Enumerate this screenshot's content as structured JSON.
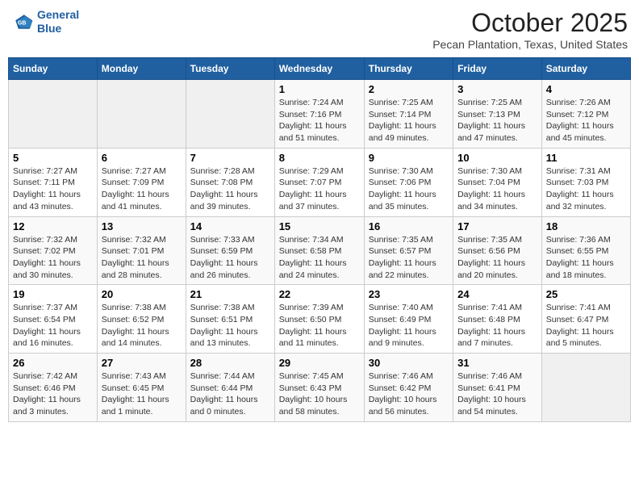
{
  "header": {
    "logo_line1": "General",
    "logo_line2": "Blue",
    "month": "October 2025",
    "location": "Pecan Plantation, Texas, United States"
  },
  "weekdays": [
    "Sunday",
    "Monday",
    "Tuesday",
    "Wednesday",
    "Thursday",
    "Friday",
    "Saturday"
  ],
  "weeks": [
    [
      {
        "day": "",
        "info": ""
      },
      {
        "day": "",
        "info": ""
      },
      {
        "day": "",
        "info": ""
      },
      {
        "day": "1",
        "info": "Sunrise: 7:24 AM\nSunset: 7:16 PM\nDaylight: 11 hours\nand 51 minutes."
      },
      {
        "day": "2",
        "info": "Sunrise: 7:25 AM\nSunset: 7:14 PM\nDaylight: 11 hours\nand 49 minutes."
      },
      {
        "day": "3",
        "info": "Sunrise: 7:25 AM\nSunset: 7:13 PM\nDaylight: 11 hours\nand 47 minutes."
      },
      {
        "day": "4",
        "info": "Sunrise: 7:26 AM\nSunset: 7:12 PM\nDaylight: 11 hours\nand 45 minutes."
      }
    ],
    [
      {
        "day": "5",
        "info": "Sunrise: 7:27 AM\nSunset: 7:11 PM\nDaylight: 11 hours\nand 43 minutes."
      },
      {
        "day": "6",
        "info": "Sunrise: 7:27 AM\nSunset: 7:09 PM\nDaylight: 11 hours\nand 41 minutes."
      },
      {
        "day": "7",
        "info": "Sunrise: 7:28 AM\nSunset: 7:08 PM\nDaylight: 11 hours\nand 39 minutes."
      },
      {
        "day": "8",
        "info": "Sunrise: 7:29 AM\nSunset: 7:07 PM\nDaylight: 11 hours\nand 37 minutes."
      },
      {
        "day": "9",
        "info": "Sunrise: 7:30 AM\nSunset: 7:06 PM\nDaylight: 11 hours\nand 35 minutes."
      },
      {
        "day": "10",
        "info": "Sunrise: 7:30 AM\nSunset: 7:04 PM\nDaylight: 11 hours\nand 34 minutes."
      },
      {
        "day": "11",
        "info": "Sunrise: 7:31 AM\nSunset: 7:03 PM\nDaylight: 11 hours\nand 32 minutes."
      }
    ],
    [
      {
        "day": "12",
        "info": "Sunrise: 7:32 AM\nSunset: 7:02 PM\nDaylight: 11 hours\nand 30 minutes."
      },
      {
        "day": "13",
        "info": "Sunrise: 7:32 AM\nSunset: 7:01 PM\nDaylight: 11 hours\nand 28 minutes."
      },
      {
        "day": "14",
        "info": "Sunrise: 7:33 AM\nSunset: 6:59 PM\nDaylight: 11 hours\nand 26 minutes."
      },
      {
        "day": "15",
        "info": "Sunrise: 7:34 AM\nSunset: 6:58 PM\nDaylight: 11 hours\nand 24 minutes."
      },
      {
        "day": "16",
        "info": "Sunrise: 7:35 AM\nSunset: 6:57 PM\nDaylight: 11 hours\nand 22 minutes."
      },
      {
        "day": "17",
        "info": "Sunrise: 7:35 AM\nSunset: 6:56 PM\nDaylight: 11 hours\nand 20 minutes."
      },
      {
        "day": "18",
        "info": "Sunrise: 7:36 AM\nSunset: 6:55 PM\nDaylight: 11 hours\nand 18 minutes."
      }
    ],
    [
      {
        "day": "19",
        "info": "Sunrise: 7:37 AM\nSunset: 6:54 PM\nDaylight: 11 hours\nand 16 minutes."
      },
      {
        "day": "20",
        "info": "Sunrise: 7:38 AM\nSunset: 6:52 PM\nDaylight: 11 hours\nand 14 minutes."
      },
      {
        "day": "21",
        "info": "Sunrise: 7:38 AM\nSunset: 6:51 PM\nDaylight: 11 hours\nand 13 minutes."
      },
      {
        "day": "22",
        "info": "Sunrise: 7:39 AM\nSunset: 6:50 PM\nDaylight: 11 hours\nand 11 minutes."
      },
      {
        "day": "23",
        "info": "Sunrise: 7:40 AM\nSunset: 6:49 PM\nDaylight: 11 hours\nand 9 minutes."
      },
      {
        "day": "24",
        "info": "Sunrise: 7:41 AM\nSunset: 6:48 PM\nDaylight: 11 hours\nand 7 minutes."
      },
      {
        "day": "25",
        "info": "Sunrise: 7:41 AM\nSunset: 6:47 PM\nDaylight: 11 hours\nand 5 minutes."
      }
    ],
    [
      {
        "day": "26",
        "info": "Sunrise: 7:42 AM\nSunset: 6:46 PM\nDaylight: 11 hours\nand 3 minutes."
      },
      {
        "day": "27",
        "info": "Sunrise: 7:43 AM\nSunset: 6:45 PM\nDaylight: 11 hours\nand 1 minute."
      },
      {
        "day": "28",
        "info": "Sunrise: 7:44 AM\nSunset: 6:44 PM\nDaylight: 11 hours\nand 0 minutes."
      },
      {
        "day": "29",
        "info": "Sunrise: 7:45 AM\nSunset: 6:43 PM\nDaylight: 10 hours\nand 58 minutes."
      },
      {
        "day": "30",
        "info": "Sunrise: 7:46 AM\nSunset: 6:42 PM\nDaylight: 10 hours\nand 56 minutes."
      },
      {
        "day": "31",
        "info": "Sunrise: 7:46 AM\nSunset: 6:41 PM\nDaylight: 10 hours\nand 54 minutes."
      },
      {
        "day": "",
        "info": ""
      }
    ]
  ]
}
